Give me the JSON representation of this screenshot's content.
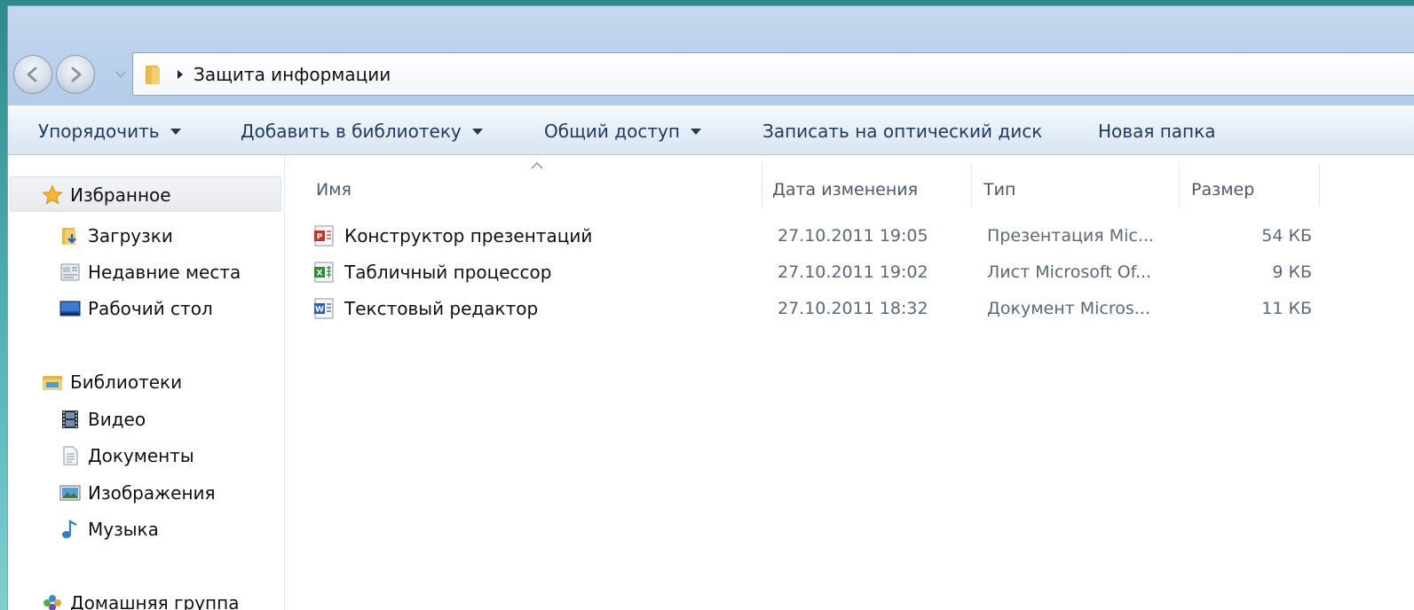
{
  "address": {
    "path_item": "Защита информации"
  },
  "toolbar": {
    "organize": "Упорядочить",
    "add_to_library": "Добавить в библиотеку",
    "share": "Общий доступ",
    "burn": "Записать на оптический диск",
    "new_folder": "Новая папка"
  },
  "sidebar": {
    "favorites": {
      "label": "Избранное",
      "items": [
        {
          "label": "Загрузки",
          "icon": "downloads-folder-icon"
        },
        {
          "label": "Недавние места",
          "icon": "recent-places-icon"
        },
        {
          "label": "Рабочий стол",
          "icon": "desktop-icon"
        }
      ]
    },
    "libraries": {
      "label": "Библиотеки",
      "items": [
        {
          "label": "Видео",
          "icon": "video-icon"
        },
        {
          "label": "Документы",
          "icon": "documents-icon"
        },
        {
          "label": "Изображения",
          "icon": "pictures-icon"
        },
        {
          "label": "Музыка",
          "icon": "music-icon"
        }
      ]
    },
    "homegroup": {
      "label": "Домашняя группа"
    }
  },
  "columns": {
    "name": "Имя",
    "date": "Дата изменения",
    "type": "Тип",
    "size": "Размер"
  },
  "files": [
    {
      "name": "Конструктор презентаций",
      "date": "27.10.2011 19:05",
      "type": "Презентация Mic...",
      "size": "54 КБ",
      "icon": "powerpoint-icon",
      "color": "#c8321e"
    },
    {
      "name": "Табличный процессор",
      "date": "27.10.2011 19:02",
      "type": "Лист Microsoft Of...",
      "size": "9 КБ",
      "icon": "excel-icon",
      "color": "#2e8b3a"
    },
    {
      "name": "Текстовый редактор",
      "date": "27.10.2011 18:32",
      "type": "Документ Micros...",
      "size": "11 КБ",
      "icon": "word-icon",
      "color": "#2b5cb8"
    }
  ]
}
